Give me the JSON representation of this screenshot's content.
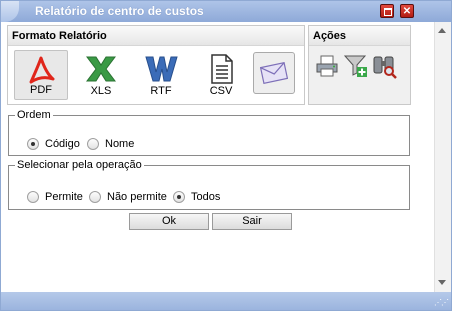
{
  "window": {
    "title": "Relatório de centro de custos"
  },
  "formato": {
    "heading": "Formato Relatório",
    "items": [
      {
        "label": "PDF",
        "icon": "pdf-icon",
        "color": "#e0261b"
      },
      {
        "label": "XLS",
        "icon": "excel-icon",
        "color": "#2e8b3a"
      },
      {
        "label": "RTF",
        "icon": "word-icon",
        "color": "#2f5fa8"
      },
      {
        "label": "CSV",
        "icon": "csv-document-icon",
        "color": "#333333"
      },
      {
        "label": "",
        "icon": "email-envelope-icon",
        "color": "#7d6fb8"
      }
    ]
  },
  "acoes": {
    "heading": "Ações",
    "icons": [
      "printer-icon",
      "filter-add-icon",
      "binoculars-search-icon"
    ]
  },
  "ordem": {
    "legend": "Ordem",
    "options": [
      "Código",
      "Nome"
    ],
    "selected": "Código"
  },
  "operacao": {
    "legend": "Selecionar pela operação",
    "options": [
      "Permite",
      "Não permite",
      "Todos"
    ],
    "selected": "Todos"
  },
  "buttons": {
    "ok": "Ok",
    "sair": "Sair"
  },
  "colors": {
    "title_bar": "#8ea9d8",
    "close_button": "#c8281d",
    "accent": "#8fa9d3"
  }
}
